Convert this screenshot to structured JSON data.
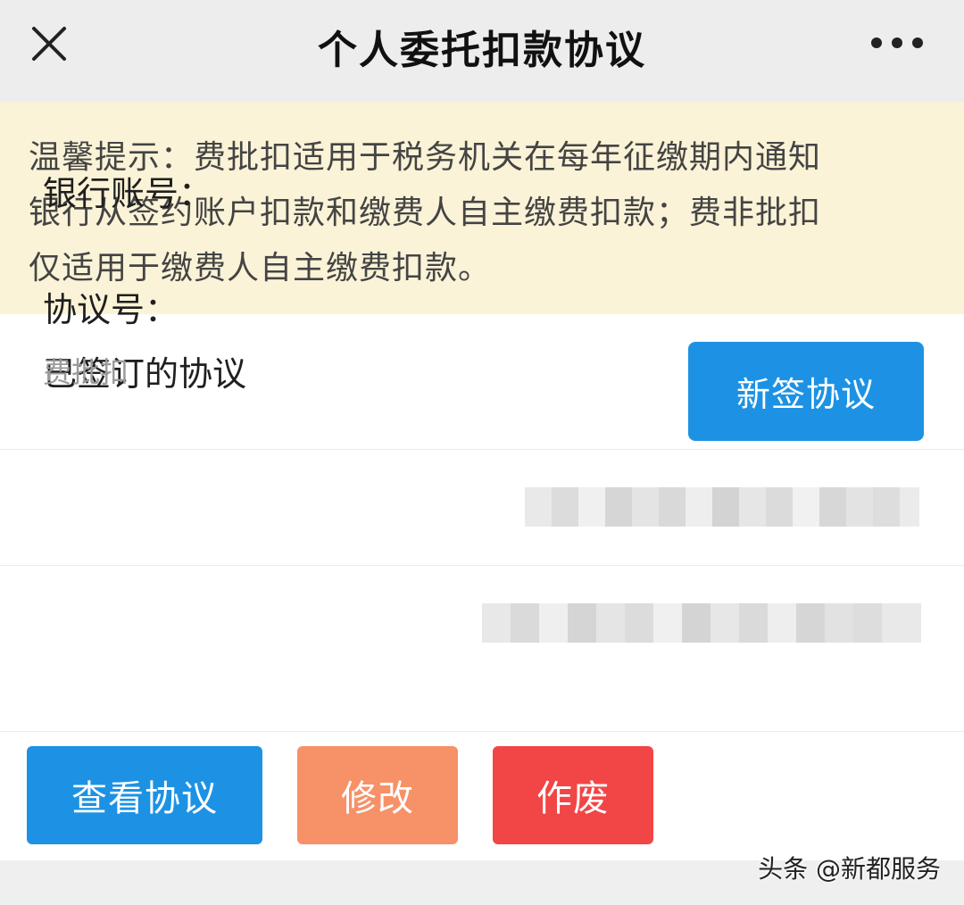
{
  "header": {
    "title": "个人委托扣款协议"
  },
  "notice": {
    "line1": "温馨提示：费批扣适用于税务机关在每年征缴期内通知",
    "line2": "银行从签约账户扣款和缴费人自主缴费扣款；费非批扣",
    "line3": "仅适用于缴费人自主缴费扣款。"
  },
  "signed": {
    "label": "已签订的协议",
    "new_button": "新签协议"
  },
  "account": {
    "label": "银行账号："
  },
  "protocol": {
    "label": "协议号：",
    "type": "费批扣"
  },
  "actions": {
    "view": "查看协议",
    "edit": "修改",
    "void": "作废"
  },
  "watermark": "头条 @新都服务",
  "colors": {
    "primary": "#1d92e4",
    "edit": "#f79168",
    "void": "#f24545",
    "notice_bg": "#fbf3d7"
  }
}
